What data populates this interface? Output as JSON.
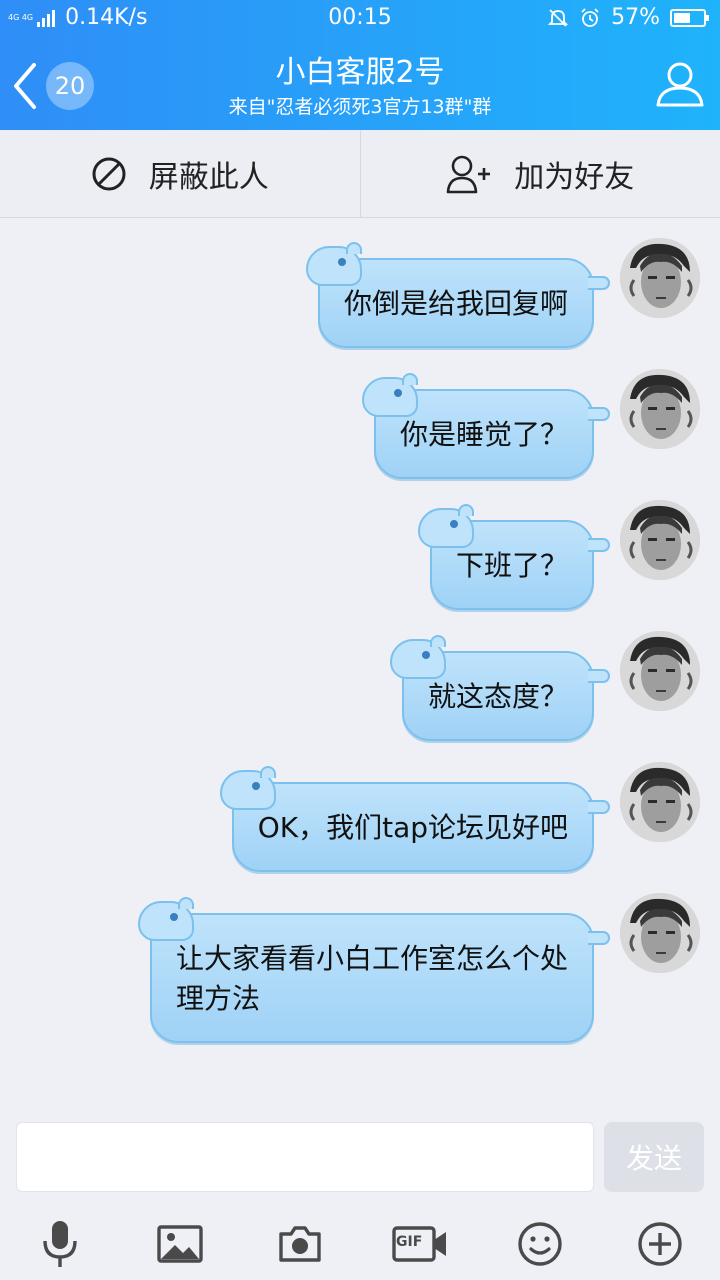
{
  "status_bar": {
    "network": "4G 4G",
    "speed": "0.14K/s",
    "time": "00:15",
    "battery": "57%",
    "battery_level": 0.57
  },
  "header": {
    "unread_count": "20",
    "title": "小白客服2号",
    "subtitle": "来自\"忍者必须死3官方13群\"群"
  },
  "actions": {
    "block_label": "屏蔽此人",
    "add_friend_label": "加为好友"
  },
  "messages": [
    {
      "text": "你倒是给我回复啊"
    },
    {
      "text": "你是睡觉了？"
    },
    {
      "text": "下班了？"
    },
    {
      "text": "就这态度？"
    },
    {
      "text": "OK，我们tap论坛见好吧"
    },
    {
      "text": "让大家看看小白工作室怎么个处理方法"
    }
  ],
  "input": {
    "value": "",
    "send_label": "发送"
  },
  "toolbar": {
    "gif_label": "GIF",
    "icons": [
      "mic-icon",
      "image-icon",
      "camera-icon",
      "gif-icon",
      "emoji-icon",
      "plus-icon"
    ]
  },
  "colors": {
    "header_start": "#2f8ef7",
    "header_end": "#1fb3fb",
    "bubble": "#a8d7f8",
    "bubble_border": "#7cc1ee"
  }
}
